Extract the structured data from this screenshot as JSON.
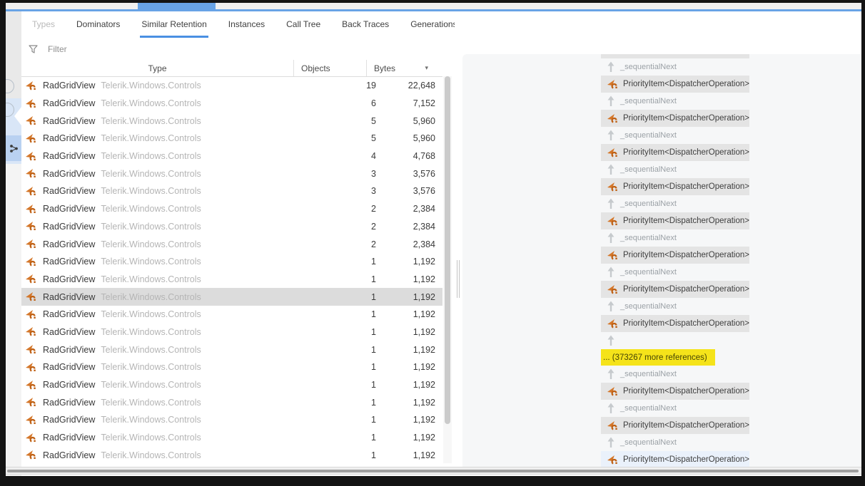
{
  "window": {
    "accent_color": "#68a3e6",
    "highlight_color": "#f5e31a"
  },
  "tabs": [
    {
      "label": "Types",
      "state": "disabled"
    },
    {
      "label": "Dominators",
      "state": "normal"
    },
    {
      "label": "Similar Retention",
      "state": "active"
    },
    {
      "label": "Instances",
      "state": "normal"
    },
    {
      "label": "Call Tree",
      "state": "normal"
    },
    {
      "label": "Back Traces",
      "state": "normal"
    },
    {
      "label": "Generations",
      "state": "normal"
    }
  ],
  "filter": {
    "label": "Filter",
    "icon": "funnel-icon"
  },
  "table": {
    "columns": {
      "type": "Type",
      "objects": "Objects",
      "bytes": "Bytes"
    },
    "sort": {
      "column": "Bytes",
      "icon": "caret-down-icon"
    },
    "row_icon": "class-icon",
    "selected_index": 12,
    "rows": [
      {
        "name": "RadGridView",
        "namespace": "Telerik.Windows.Controls",
        "objects": "19",
        "bytes": "22,648"
      },
      {
        "name": "RadGridView",
        "namespace": "Telerik.Windows.Controls",
        "objects": "6",
        "bytes": "7,152"
      },
      {
        "name": "RadGridView",
        "namespace": "Telerik.Windows.Controls",
        "objects": "5",
        "bytes": "5,960"
      },
      {
        "name": "RadGridView",
        "namespace": "Telerik.Windows.Controls",
        "objects": "5",
        "bytes": "5,960"
      },
      {
        "name": "RadGridView",
        "namespace": "Telerik.Windows.Controls",
        "objects": "4",
        "bytes": "4,768"
      },
      {
        "name": "RadGridView",
        "namespace": "Telerik.Windows.Controls",
        "objects": "3",
        "bytes": "3,576"
      },
      {
        "name": "RadGridView",
        "namespace": "Telerik.Windows.Controls",
        "objects": "3",
        "bytes": "3,576"
      },
      {
        "name": "RadGridView",
        "namespace": "Telerik.Windows.Controls",
        "objects": "2",
        "bytes": "2,384"
      },
      {
        "name": "RadGridView",
        "namespace": "Telerik.Windows.Controls",
        "objects": "2",
        "bytes": "2,384"
      },
      {
        "name": "RadGridView",
        "namespace": "Telerik.Windows.Controls",
        "objects": "2",
        "bytes": "2,384"
      },
      {
        "name": "RadGridView",
        "namespace": "Telerik.Windows.Controls",
        "objects": "1",
        "bytes": "1,192"
      },
      {
        "name": "RadGridView",
        "namespace": "Telerik.Windows.Controls",
        "objects": "1",
        "bytes": "1,192"
      },
      {
        "name": "RadGridView",
        "namespace": "Telerik.Windows.Controls",
        "objects": "1",
        "bytes": "1,192"
      },
      {
        "name": "RadGridView",
        "namespace": "Telerik.Windows.Controls",
        "objects": "1",
        "bytes": "1,192"
      },
      {
        "name": "RadGridView",
        "namespace": "Telerik.Windows.Controls",
        "objects": "1",
        "bytes": "1,192"
      },
      {
        "name": "RadGridView",
        "namespace": "Telerik.Windows.Controls",
        "objects": "1",
        "bytes": "1,192"
      },
      {
        "name": "RadGridView",
        "namespace": "Telerik.Windows.Controls",
        "objects": "1",
        "bytes": "1,192"
      },
      {
        "name": "RadGridView",
        "namespace": "Telerik.Windows.Controls",
        "objects": "1",
        "bytes": "1,192"
      },
      {
        "name": "RadGridView",
        "namespace": "Telerik.Windows.Controls",
        "objects": "1",
        "bytes": "1,192"
      },
      {
        "name": "RadGridView",
        "namespace": "Telerik.Windows.Controls",
        "objects": "1",
        "bytes": "1,192"
      },
      {
        "name": "RadGridView",
        "namespace": "Telerik.Windows.Controls",
        "objects": "1",
        "bytes": "1,192"
      },
      {
        "name": "RadGridView",
        "namespace": "Telerik.Windows.Controls",
        "objects": "1",
        "bytes": "1,192"
      }
    ]
  },
  "graph": {
    "node_label": "PriorityItem<DispatcherOperation>",
    "edge_label": "_sequentialNext",
    "more_label": "... (373267 more references)",
    "node_icon": "class-icon",
    "edge_icon": "arrow-up-icon",
    "sequence": [
      "node_partial",
      "edge",
      "node",
      "edge",
      "node",
      "edge",
      "node",
      "edge",
      "node",
      "edge",
      "node",
      "edge",
      "node",
      "edge",
      "node",
      "edge",
      "node",
      "edge_plain",
      "more",
      "edge",
      "node",
      "edge",
      "node",
      "edge",
      "node_selected"
    ]
  },
  "rail": {
    "selected_icon": "graph-icon"
  }
}
